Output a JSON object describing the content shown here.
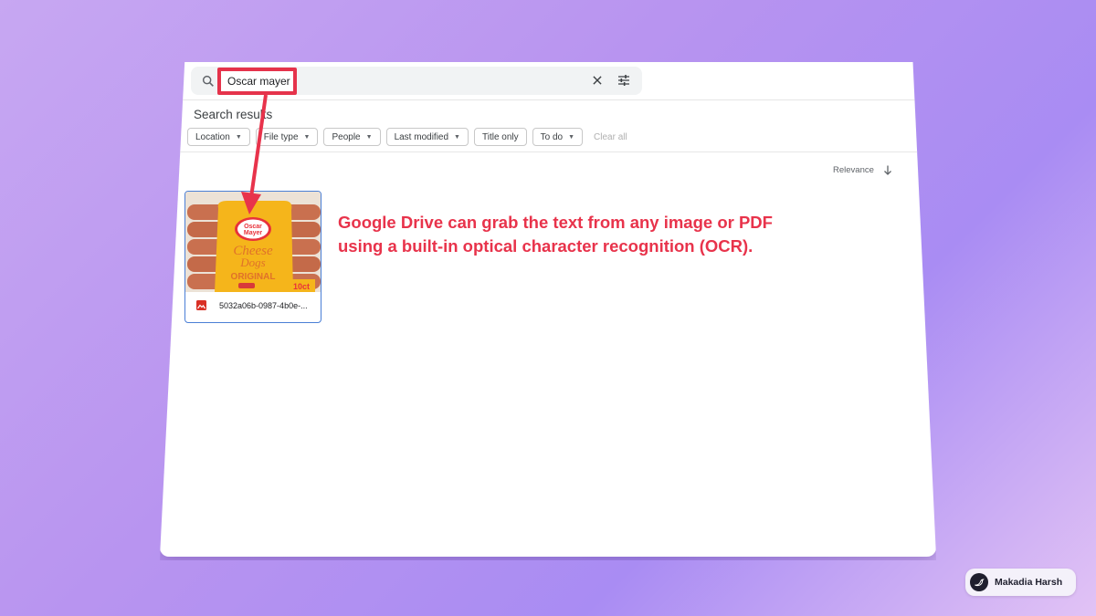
{
  "search": {
    "query": "Oscar mayer"
  },
  "results": {
    "title": "Search results",
    "sort_label": "Relevance",
    "filters": [
      {
        "label": "Location",
        "has_dropdown": true
      },
      {
        "label": "File type",
        "has_dropdown": true
      },
      {
        "label": "People",
        "has_dropdown": true
      },
      {
        "label": "Last modified",
        "has_dropdown": true
      },
      {
        "label": "Title only",
        "has_dropdown": false
      },
      {
        "label": "To do",
        "has_dropdown": true
      }
    ],
    "clear_all": "Clear all",
    "files": [
      {
        "name": "5032a06b-0987-4b0e-...",
        "type_icon": "image-file-icon"
      }
    ]
  },
  "thumbnail": {
    "brand_line1": "Oscar",
    "brand_line2": "Mayer",
    "product_line1": "Cheese",
    "product_line2": "Dogs",
    "variant": "ORIGINAL",
    "count": "10ct"
  },
  "annotation": {
    "line1": "Google Drive can grab the text from any image or PDF",
    "line2": "using a built-in optical character recognition (OCR)."
  },
  "credit": {
    "name": "Makadia Harsh",
    "icon": "bird-icon"
  },
  "colors": {
    "accent_red": "#e8334b",
    "selection_blue": "#4a7fd6",
    "background_purple": "#b894f0"
  }
}
